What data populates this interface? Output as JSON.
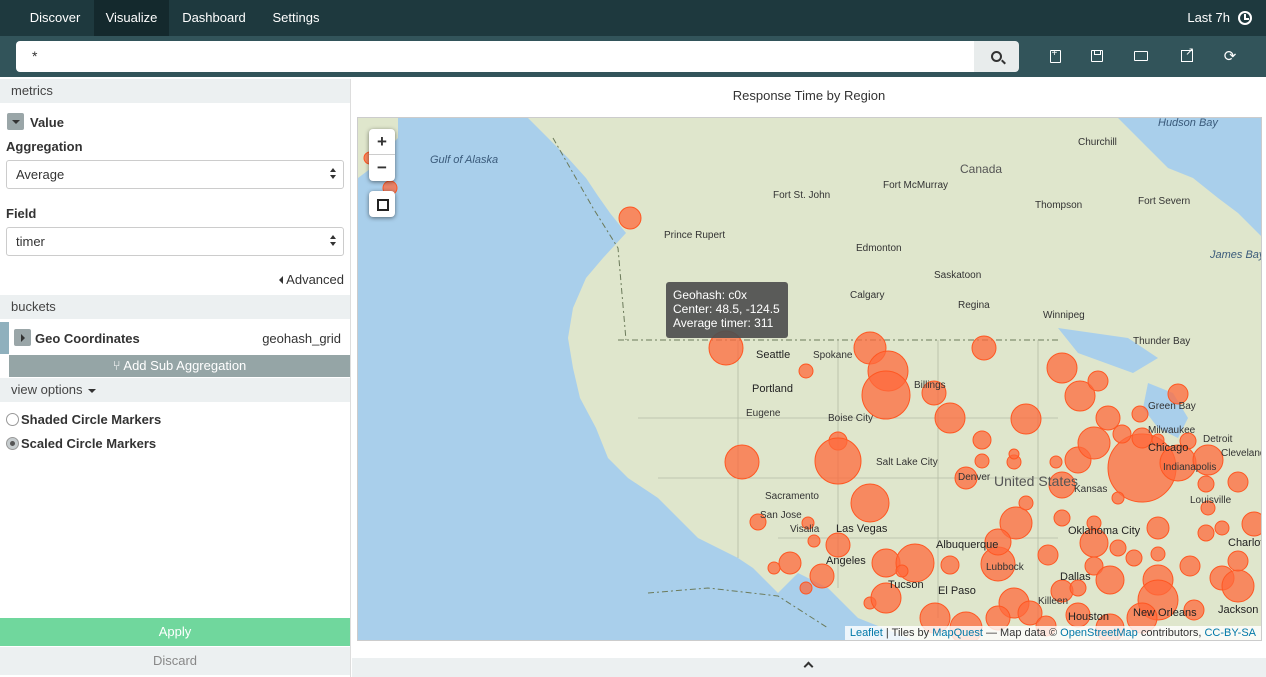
{
  "nav": {
    "tabs": [
      {
        "label": "Discover",
        "active": false
      },
      {
        "label": "Visualize",
        "active": true
      },
      {
        "label": "Dashboard",
        "active": false
      },
      {
        "label": "Settings",
        "active": false
      }
    ],
    "time_range": "Last 7h"
  },
  "search": {
    "value": "*",
    "icons": [
      "new-document-icon",
      "save-icon",
      "open-folder-icon",
      "share-icon",
      "refresh-icon"
    ]
  },
  "sidebar": {
    "metrics_header": "metrics",
    "metric_label": "Value",
    "aggregation_label": "Aggregation",
    "aggregation_value": "Average",
    "field_label": "Field",
    "field_value": "timer",
    "advanced_label": "Advanced",
    "buckets_header": "buckets",
    "bucket_name": "Geo Coordinates",
    "bucket_type": "geohash_grid",
    "add_sub_label": "Add Sub Aggregation",
    "view_options_label": "view options",
    "marker_options": [
      {
        "label": "Shaded Circle Markers",
        "selected": false
      },
      {
        "label": "Scaled Circle Markers",
        "selected": true
      }
    ],
    "apply_label": "Apply",
    "discard_label": "Discard"
  },
  "visualization": {
    "title": "Response Time by Region",
    "zoom_in": "+",
    "zoom_out": "−",
    "tooltip": {
      "line1": "Geohash: c0x",
      "line2": "Center: 48.5, -124.5",
      "line3": "Average timer: 311"
    },
    "attribution": {
      "leaflet": "Leaflet",
      "tiles_by": " | Tiles by ",
      "mapquest": "MapQuest",
      "map_data": " — Map data © ",
      "osm": "OpenStreetMap",
      "contributors": " contributors, ",
      "license": "CC-BY-SA"
    },
    "map_labels": [
      "Gulf of Alaska",
      "Hudson Bay",
      "Churchill",
      "Canada",
      "Fort St. John",
      "Fort McMurray",
      "Thompson",
      "Fort Severn",
      "Prince Rupert",
      "Edmonton",
      "James Bay",
      "Saskatoon",
      "Calgary",
      "Regina",
      "Winnipeg",
      "Thunder Bay",
      "Seattle",
      "Spokane",
      "Portland",
      "Billings",
      "Green Bay",
      "Eugene",
      "Boise City",
      "Milwaukee",
      "Detroit",
      "Cleveland",
      "Salt Lake City",
      "Denver",
      "United States",
      "Kansas",
      "Indianapolis",
      "Louisville",
      "Sacramento",
      "San Jose",
      "Visalia",
      "Las Vegas",
      "Oklahoma City",
      "Albuquerque",
      "Lubbock",
      "Dallas",
      "Tucson",
      "El Paso",
      "Killeen",
      "Houston",
      "Jackson",
      "New Orleans",
      "Charlotte",
      "Chicago",
      "Angeles"
    ],
    "marker_color": "#ff6a3c",
    "water_color": "#a9cfeb",
    "land_color": "#dfe6cc"
  }
}
